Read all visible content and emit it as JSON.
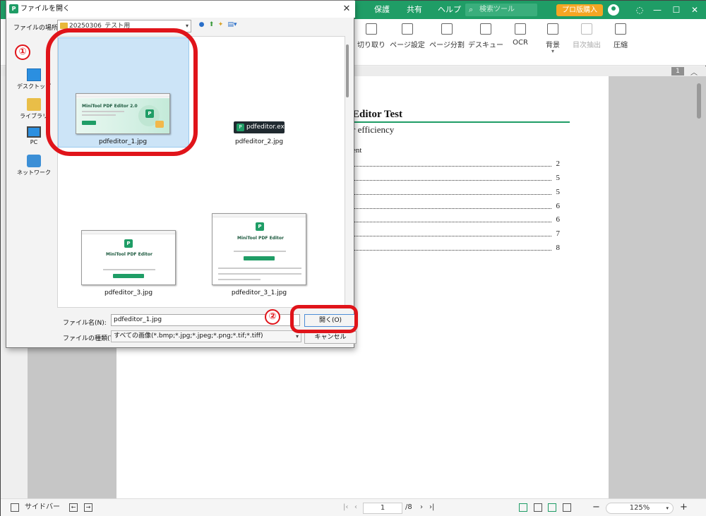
{
  "app": {
    "menus": [
      "保護",
      "共有",
      "ヘルプ"
    ],
    "search_placeholder": "検索ツール",
    "pro_button": "プロ版購入",
    "tools": [
      "切り取り",
      "ページ設定",
      "ページ分割",
      "デスキュー",
      "OCR",
      "背景",
      "目次抽出",
      "圧縮"
    ],
    "tool_bg_sub": "▾",
    "page_badge": "1"
  },
  "document": {
    "title": "Editor Test",
    "subtitle": "r efficiency",
    "toc_heading": "ent",
    "toc_pages": [
      "2",
      "5",
      "5",
      "6",
      "6",
      "7",
      "8"
    ]
  },
  "statusbar": {
    "sidebar_label": "サイドバー",
    "current_page": "1",
    "total_pages": "/8",
    "zoom": "125%"
  },
  "dialog": {
    "title": "ファイルを開く",
    "location_label": "ファイルの場所(I):",
    "location_value": "20250306_テスト用",
    "places": [
      "デスクトップ",
      "ライブラリ",
      "PC",
      "ネットワーク"
    ],
    "files": [
      {
        "name": "pdfeditor_1.jpg",
        "selected": true
      },
      {
        "name": "pdfeditor_2.jpg",
        "chip_text": "pdfeditor.exe"
      },
      {
        "name": "pdfeditor_3.jpg",
        "preview_title": "MiniTool PDF Editor"
      },
      {
        "name": "pdfeditor_3_1.jpg",
        "preview_title": "MiniTool PDF Editor"
      }
    ],
    "file1_preview_title": "MiniTool PDF Editor 2.0",
    "filename_label": "ファイル名(N):",
    "filename_value": "pdfeditor_1.jpg",
    "filetype_label": "ファイルの種類(T):",
    "filetype_value": "すべての画像(*.bmp;*.jpg;*.jpeg;*.png;*.tif;*.tiff)",
    "open_button": "開く(O)",
    "cancel_button": "キャンセル"
  },
  "annotations": {
    "step1": "①",
    "step2": "②"
  },
  "colors": {
    "brand": "#1f9d66",
    "pro": "#f5a623",
    "annotation": "#e0141a"
  }
}
